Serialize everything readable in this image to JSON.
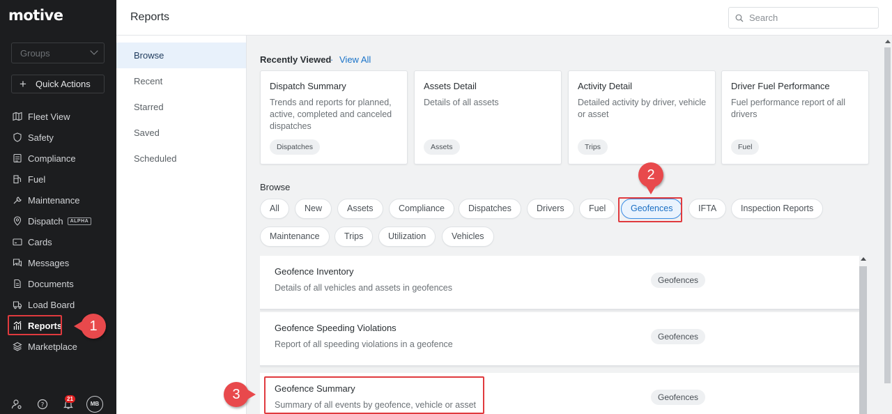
{
  "brand": {
    "logo": "motive"
  },
  "sidebar": {
    "groups_placeholder": "Groups",
    "quick_actions": "Quick Actions",
    "items": [
      {
        "label": "Fleet View",
        "icon": "map-icon"
      },
      {
        "label": "Safety",
        "icon": "shield-icon"
      },
      {
        "label": "Compliance",
        "icon": "checklist-icon"
      },
      {
        "label": "Fuel",
        "icon": "fuel-pump-icon"
      },
      {
        "label": "Maintenance",
        "icon": "wrench-icon"
      },
      {
        "label": "Dispatch",
        "icon": "location-pin-icon",
        "badge": "ALPHA"
      },
      {
        "label": "Cards",
        "icon": "credit-card-icon"
      },
      {
        "label": "Messages",
        "icon": "chat-icon"
      },
      {
        "label": "Documents",
        "icon": "document-icon"
      },
      {
        "label": "Load Board",
        "icon": "truck-icon"
      },
      {
        "label": "Reports",
        "icon": "bar-chart-icon",
        "active": true
      },
      {
        "label": "Marketplace",
        "icon": "layers-icon"
      }
    ],
    "notifications_count": "21",
    "avatar_initials": "MB"
  },
  "header": {
    "title": "Reports",
    "search_placeholder": "Search"
  },
  "subnav": {
    "items": [
      "Browse",
      "Recent",
      "Starred",
      "Saved",
      "Scheduled"
    ],
    "active": "Browse"
  },
  "recently_viewed": {
    "title": "Recently Viewed",
    "separator": "·",
    "view_all": "View All",
    "cards": [
      {
        "title": "Dispatch Summary",
        "desc": "Trends and reports for planned, active, completed and canceled dispatches",
        "tag": "Dispatches"
      },
      {
        "title": "Assets Detail",
        "desc": "Details of all assets",
        "tag": "Assets"
      },
      {
        "title": "Activity Detail",
        "desc": "Detailed activity by driver, vehicle or asset",
        "tag": "Trips"
      },
      {
        "title": "Driver Fuel Performance",
        "desc": "Fuel performance report of all drivers",
        "tag": "Fuel"
      }
    ]
  },
  "browse": {
    "title": "Browse",
    "chips": [
      "All",
      "New",
      "Assets",
      "Compliance",
      "Dispatches",
      "Drivers",
      "Fuel",
      "Geofences",
      "IFTA",
      "Inspection Reports",
      "Maintenance",
      "Trips",
      "Utilization",
      "Vehicles"
    ],
    "selected": "Geofences"
  },
  "reports": [
    {
      "title": "Geofence Inventory",
      "desc": "Details of all vehicles and assets in geofences",
      "tag": "Geofences"
    },
    {
      "title": "Geofence Speeding Violations",
      "desc": "Report of all speeding violations in a geofence",
      "tag": "Geofences"
    },
    {
      "title": "Geofence Summary",
      "desc": "Summary of all events by geofence, vehicle or asset",
      "tag": "Geofences"
    }
  ],
  "annotations": {
    "step1": "1",
    "step2": "2",
    "step3": "3",
    "color": "#e8494c"
  }
}
